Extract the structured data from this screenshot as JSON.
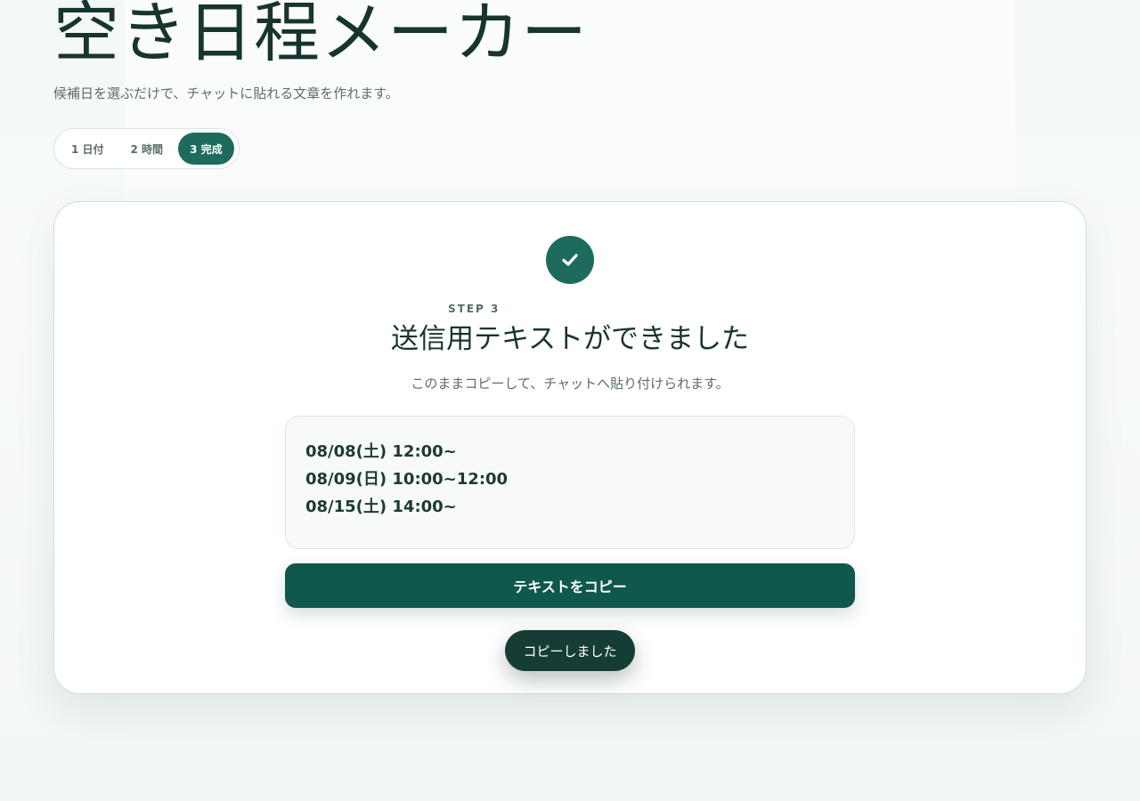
{
  "header": {
    "title": "空き日程メーカー",
    "subtitle": "候補日を選ぶだけで、チャットに貼れる文章を作れます。"
  },
  "stepper": {
    "steps": [
      {
        "label": "1 日付",
        "active": false
      },
      {
        "label": "2 時間",
        "active": false
      },
      {
        "label": "3 完成",
        "active": true
      }
    ]
  },
  "result": {
    "icon": "check-icon",
    "eyebrow": "STEP 3",
    "title": "送信用テキストができました",
    "description": "このままコピーして、チャットへ貼り付けられます。",
    "lines": [
      "08/08(土) 12:00~",
      "08/09(日) 10:00~12:00",
      "08/15(土) 14:00~"
    ],
    "copy_button_label": "テキストをコピー",
    "toast": "コピーしました"
  },
  "colors": {
    "accent": "#1c6b5c",
    "button": "#10574c",
    "toast": "#163d35",
    "text": "#17352e"
  }
}
